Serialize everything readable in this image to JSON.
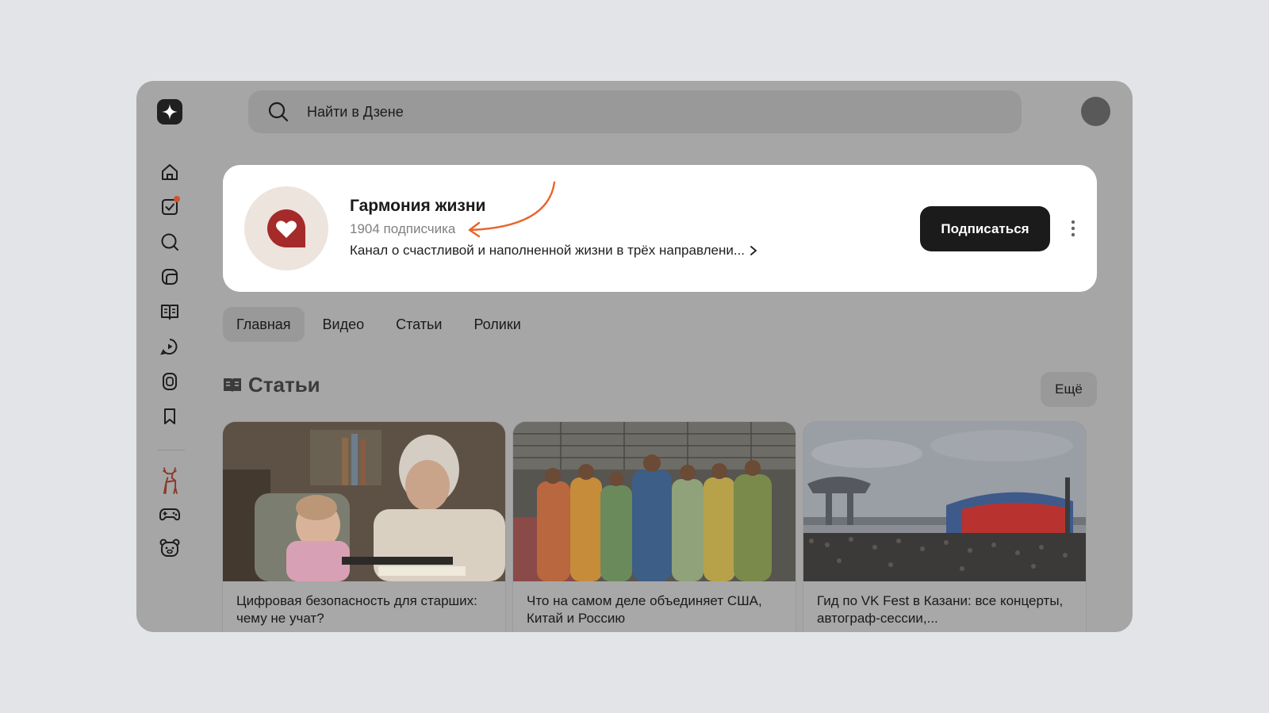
{
  "search": {
    "placeholder": "Найти в Дзене"
  },
  "sidebar": {
    "items": [
      {
        "icon": "home-icon"
      },
      {
        "icon": "subscriptions-icon",
        "badge": true
      },
      {
        "icon": "search-icon"
      },
      {
        "icon": "feed-icon"
      },
      {
        "icon": "articles-icon"
      },
      {
        "icon": "video-icon"
      },
      {
        "icon": "shorts-icon"
      },
      {
        "icon": "bookmark-icon"
      },
      {
        "icon": "deer-icon"
      },
      {
        "icon": "gamepad-icon"
      },
      {
        "icon": "bear-icon"
      }
    ]
  },
  "channel": {
    "name": "Гармония жизни",
    "subscribers": "1904 подписчика",
    "description": "Канал о счастливой и наполненной жизни в трёх направлени...",
    "subscribe_label": "Подписаться",
    "accent_color": "#a52a2a"
  },
  "tabs": [
    {
      "label": "Главная",
      "active": true
    },
    {
      "label": "Видео",
      "active": false
    },
    {
      "label": "Статьи",
      "active": false
    },
    {
      "label": "Ролики",
      "active": false
    }
  ],
  "section": {
    "title": "Статьи",
    "more_label": "Ещё"
  },
  "articles": [
    {
      "title": "Цифровая безопасность для старших: чему не учат?"
    },
    {
      "title": "Что на самом деле объединяет США, Китай и Россию"
    },
    {
      "title": "Гид по VK Fest в Казани: все концерты, автограф-сессии,..."
    }
  ],
  "colors": {
    "annotation_arrow": "#e8652b",
    "overlay": "#a6a6a6"
  }
}
